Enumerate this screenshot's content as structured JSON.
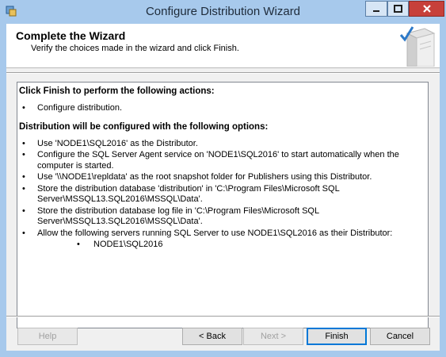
{
  "window": {
    "title": "Configure Distribution Wizard"
  },
  "header": {
    "title": "Complete the Wizard",
    "subtitle": "Verify the choices made in the wizard and click Finish."
  },
  "summary": {
    "heading1": "Click Finish to perform the following actions:",
    "actions": [
      "Configure distribution."
    ],
    "heading2": "Distribution will be configured with the following options:",
    "options": [
      "Use 'NODE1\\SQL2016' as the Distributor.",
      "Configure the SQL Server Agent service on 'NODE1\\SQL2016' to start automatically when the computer is started.",
      "Use '\\\\NODE1\\repldata' as the root snapshot folder for Publishers using this Distributor.",
      "Store the distribution database 'distribution' in 'C:\\Program Files\\Microsoft SQL Server\\MSSQL13.SQL2016\\MSSQL\\Data'.",
      "Store the distribution database log file in 'C:\\Program Files\\Microsoft SQL Server\\MSSQL13.SQL2016\\MSSQL\\Data'.",
      "Allow the following servers running SQL Server to use NODE1\\SQL2016 as their Distributor:"
    ],
    "servers": [
      "NODE1\\SQL2016"
    ]
  },
  "buttons": {
    "help": "Help",
    "back": "< Back",
    "next": "Next >",
    "finish": "Finish",
    "cancel": "Cancel"
  },
  "bullet": "•"
}
